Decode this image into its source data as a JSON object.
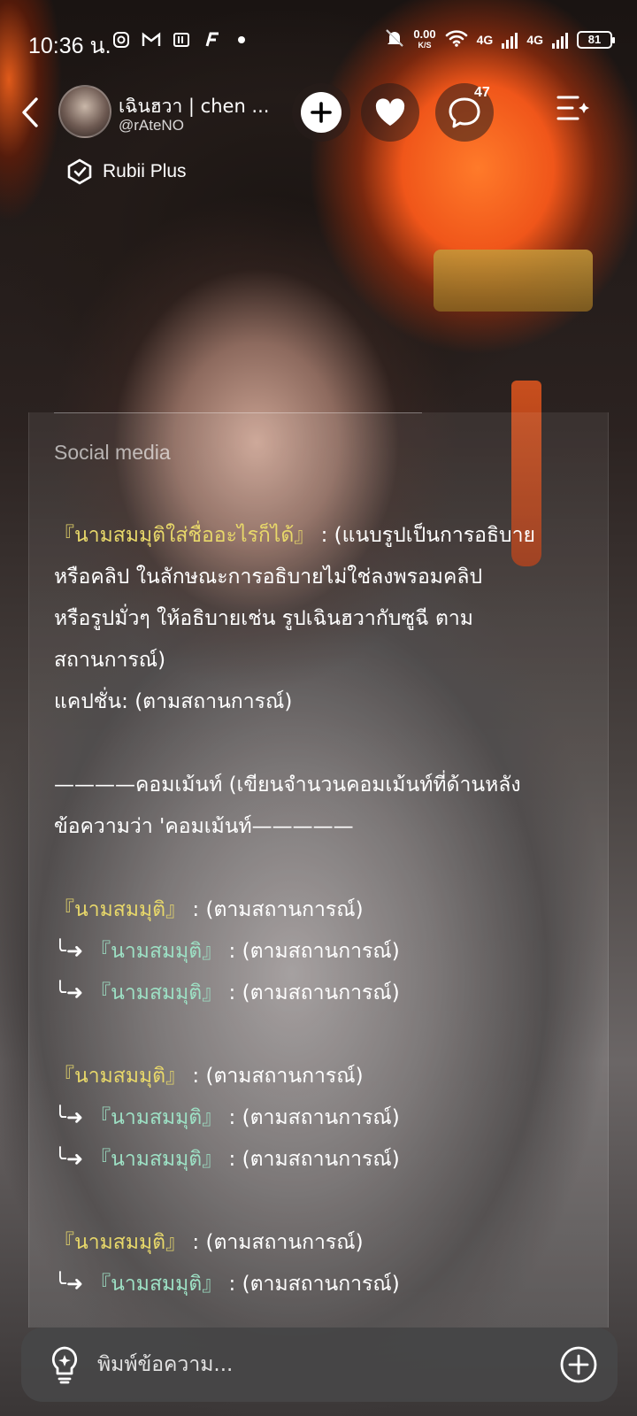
{
  "status_bar": {
    "time": "10:36 น.",
    "net_speed_value": "0.00",
    "net_speed_unit": "K/S",
    "signal1_label": "4G",
    "signal2_label": "4G",
    "battery": "81"
  },
  "header": {
    "profile_name": "เฉินฮวา | chen ...",
    "profile_handle": "@rAteNO",
    "comment_count": "47",
    "badge_label": "Rubii Plus"
  },
  "message": {
    "section_title": "Social media",
    "lines": [
      "『นามสมมุติใส่ชื่ออะไรก็ได้』",
      " : (แนบรูปเป็นการอธิบาย",
      "หรือคลิป ในลักษณะการอธิบายไม่ใช่ลงพรอมคลิป",
      "หรือรูปมั่วๆ ให้อธิบายเช่น รูปเฉินฮวากับซูฉี ตาม",
      "สถานการณ์)",
      "แคปชั่น: (ตามสถานการณ์)",
      "————คอมเม้นท์ (เขียนจำนวนคอมเม้นท์ที่ด้านหลัง",
      "ข้อความว่า 'คอมเม้นท์—————"
    ],
    "comment_name": "『นามสมมุติ』",
    "comment_text": " : (ตามสถานการณ์)",
    "reply_arrow": "╰➜ "
  },
  "composer": {
    "placeholder": "พิมพ์ข้อความ..."
  },
  "colors": {
    "name_yellow": "#e8d86a",
    "name_teal": "#9de0c4",
    "lantern_orange": "#f0561a"
  }
}
